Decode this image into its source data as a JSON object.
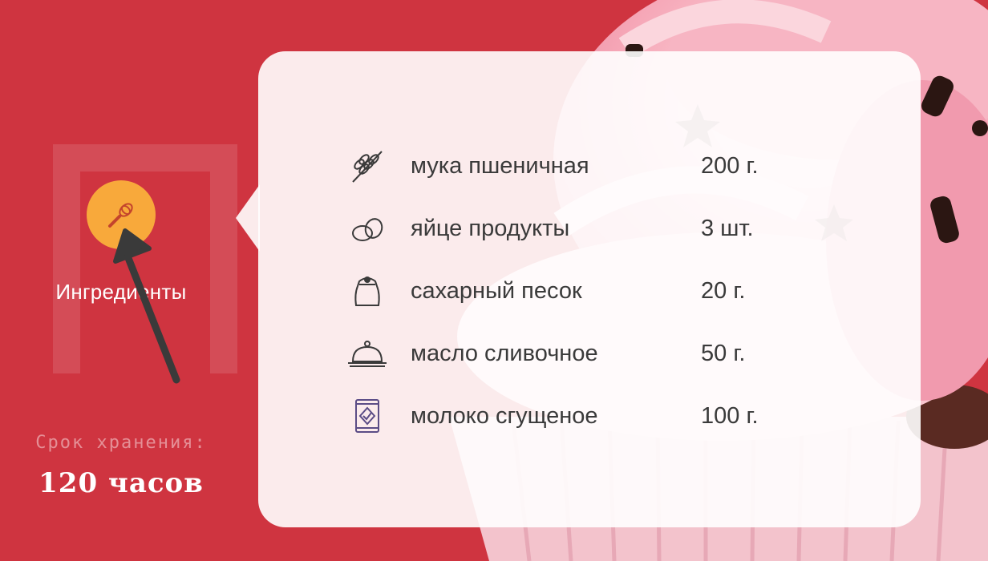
{
  "nav": {
    "label": "Ингредиенты",
    "icon": "whisk-icon"
  },
  "shelf_life": {
    "label": "Срок хранения:",
    "value": "120 часов"
  },
  "ingredients": [
    {
      "name": "мука пшеничная",
      "qty": "200 г.",
      "icon": "wheat-icon"
    },
    {
      "name": "яйце продукты",
      "qty": "3 шт.",
      "icon": "eggs-icon"
    },
    {
      "name": "сахарный песок",
      "qty": "20 г.",
      "icon": "sugar-sack-icon"
    },
    {
      "name": "масло сливочное",
      "qty": "50 г.",
      "icon": "butter-dish-icon"
    },
    {
      "name": "молоко сгущеное",
      "qty": "100 г.",
      "icon": "condensed-milk-can-icon"
    }
  ],
  "colors": {
    "background": "#cf3440",
    "accent": "#f8a93b",
    "text": "#3a3a3a"
  }
}
